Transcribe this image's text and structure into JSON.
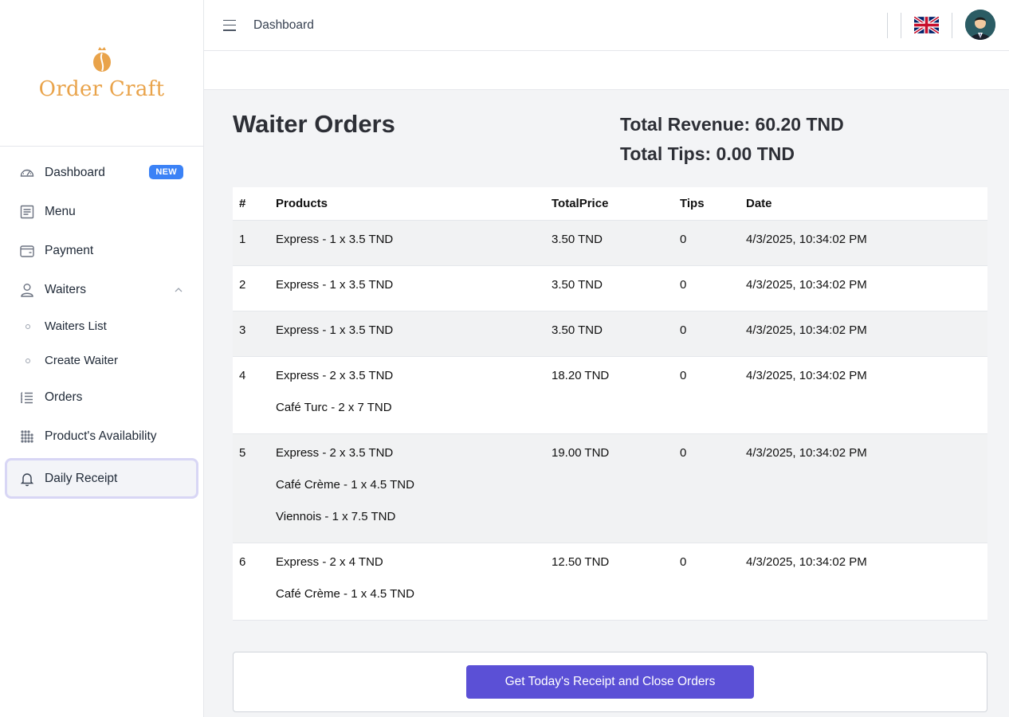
{
  "app": {
    "name": "Order Craft",
    "brand_color": "#e9a34a",
    "accent_color": "#5b50d6"
  },
  "header": {
    "breadcrumb": "Dashboard",
    "language_flag": "uk-flag-icon"
  },
  "sidebar": {
    "items": [
      {
        "label": "Dashboard",
        "icon": "speedometer-icon",
        "badge": "NEW"
      },
      {
        "label": "Menu",
        "icon": "menu-list-icon"
      },
      {
        "label": "Payment",
        "icon": "wallet-icon"
      },
      {
        "label": "Waiters",
        "icon": "user-icon",
        "expanded": true,
        "children": [
          {
            "label": "Waiters List"
          },
          {
            "label": "Create Waiter"
          }
        ]
      },
      {
        "label": "Orders",
        "icon": "list-icon"
      },
      {
        "label": "Product's Availability",
        "icon": "grid-dots-icon"
      },
      {
        "label": "Daily Receipt",
        "icon": "bell-icon",
        "active": true
      }
    ]
  },
  "main": {
    "title": "Waiter Orders",
    "total_revenue": "Total Revenue: 60.20 TND",
    "total_tips": "Total Tips: 0.00 TND",
    "table": {
      "columns": [
        "#",
        "Products",
        "TotalPrice",
        "Tips",
        "Date"
      ],
      "rows": [
        {
          "num": "1",
          "products": [
            "Express - 1 x 3.5 TND"
          ],
          "total": "3.50 TND",
          "tips": "0",
          "date": "4/3/2025, 10:34:02 PM"
        },
        {
          "num": "2",
          "products": [
            "Express - 1 x 3.5 TND"
          ],
          "total": "3.50 TND",
          "tips": "0",
          "date": "4/3/2025, 10:34:02 PM"
        },
        {
          "num": "3",
          "products": [
            "Express - 1 x 3.5 TND"
          ],
          "total": "3.50 TND",
          "tips": "0",
          "date": "4/3/2025, 10:34:02 PM"
        },
        {
          "num": "4",
          "products": [
            "Express - 2 x 3.5 TND",
            "Café Turc - 2 x 7 TND"
          ],
          "total": "18.20 TND",
          "tips": "0",
          "date": "4/3/2025, 10:34:02 PM"
        },
        {
          "num": "5",
          "products": [
            "Express - 2 x 3.5 TND",
            "Café Crème - 1 x 4.5 TND",
            "Viennois - 1 x 7.5 TND"
          ],
          "total": "19.00 TND",
          "tips": "0",
          "date": "4/3/2025, 10:34:02 PM"
        },
        {
          "num": "6",
          "products": [
            "Express - 2 x 4 TND",
            "Café Crème - 1 x 4.5 TND"
          ],
          "total": "12.50 TND",
          "tips": "0",
          "date": "4/3/2025, 10:34:02 PM"
        }
      ]
    },
    "receipt_button": "Get Today's Receipt and Close Orders"
  }
}
